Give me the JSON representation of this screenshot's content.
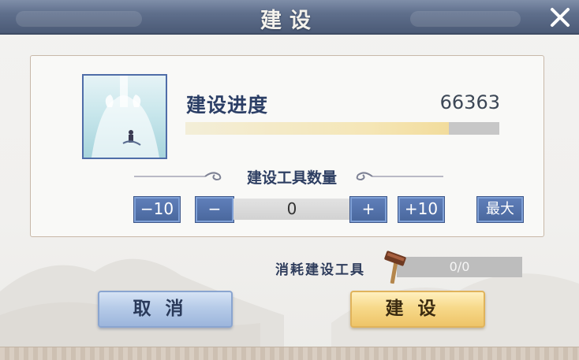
{
  "dialog": {
    "title": "建设",
    "progress": {
      "label": "建设进度",
      "value": "66363",
      "fill_fraction": 0.84
    },
    "tool_section": {
      "title": "建设工具数量",
      "minus10_label": "−10",
      "minus_label": "−",
      "quantity": "0",
      "plus_label": "+",
      "plus10_label": "+10",
      "max_label": "最大"
    },
    "consume": {
      "label": "消耗建设工具",
      "value": "0/0"
    },
    "buttons": {
      "cancel": "取消",
      "build": "建设"
    }
  },
  "icons": {
    "close": "close-icon",
    "hammer": "hammer-icon",
    "building_image": "building-thumbnail"
  },
  "colors": {
    "header": "#5f6f8c",
    "blue_button": "#4a689e",
    "build_button": "#f7d98a",
    "cancel_button": "#b6cbe8",
    "progress_fill": "#f5e6b6",
    "title_text": "#2c3f66"
  }
}
